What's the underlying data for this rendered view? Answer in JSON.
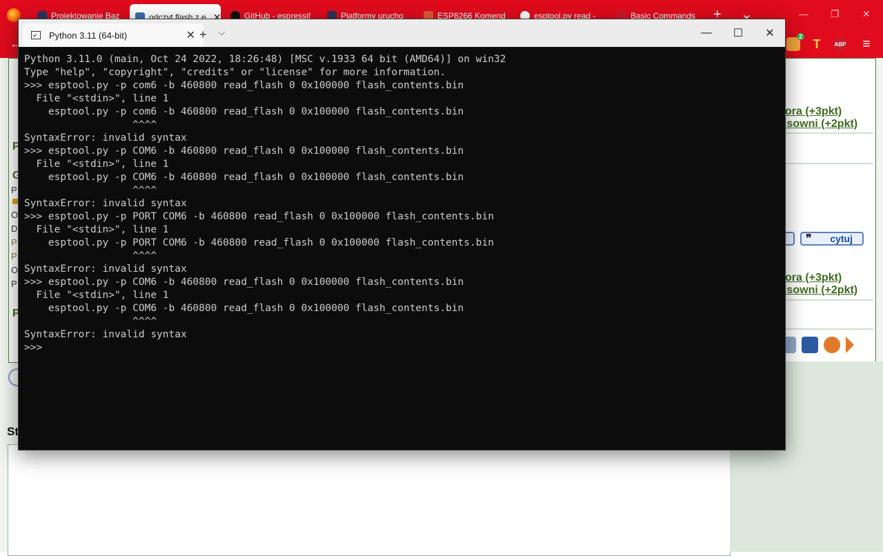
{
  "browser": {
    "tabs": [
      {
        "title": "Projektowanie Baz",
        "active": false
      },
      {
        "title": "odczyt flash z e",
        "active": true
      },
      {
        "title": "GitHub - espressif",
        "active": false
      },
      {
        "title": "Platformy urucho",
        "active": false
      },
      {
        "title": "ESP8266 Komend",
        "active": false
      },
      {
        "title": "esptool.py read -",
        "active": false
      },
      {
        "title": "Basic Commands",
        "active": false
      }
    ],
    "close_glyph": "✕",
    "new_tab_glyph": "+",
    "list_tabs_glyph": "⌄",
    "back_glyph": "←",
    "menu_glyph": "≡",
    "extension_badge": "2",
    "extension_t_label": "T",
    "extension_abp_label": "ABP",
    "window_controls": [
      "—",
      "❐",
      "✕"
    ]
  },
  "webpage": {
    "links_top": [
      "ora (+3pkt)",
      "isowni (+2pkt)"
    ],
    "links_bottom": [
      "ora (+3pkt)",
      "isowni (+2pkt)"
    ],
    "quote_label": "cytuj",
    "quote_icon_glyph": "❞",
    "left_letters": [
      "P",
      "O",
      "D",
      "P",
      "P",
      "O",
      "P"
    ],
    "left_header_1": "P",
    "left_header_2": "G",
    "left_header_3": "P",
    "section_prefix": "St"
  },
  "terminal": {
    "tab_title": "Python 3.11 (64-bit)",
    "tab_close": "✕",
    "new_tab": "+",
    "dropdown": "⌵",
    "controls": {
      "minimize": "—",
      "maximize": "☐",
      "close": "✕"
    },
    "lines": [
      "Python 3.11.0 (main, Oct 24 2022, 18:26:48) [MSC v.1933 64 bit (AMD64)] on win32",
      "Type \"help\", \"copyright\", \"credits\" or \"license\" for more information.",
      ">>> esptool.py -p com6 -b 460800 read_flash 0 0x100000 flash_contents.bin",
      "  File \"<stdin>\", line 1",
      "    esptool.py -p com6 -b 460800 read_flash 0 0x100000 flash_contents.bin",
      "                  ^^^^",
      "SyntaxError: invalid syntax",
      ">>> esptool.py -p COM6 -b 460800 read_flash 0 0x100000 flash_contents.bin",
      "  File \"<stdin>\", line 1",
      "    esptool.py -p COM6 -b 460800 read_flash 0 0x100000 flash_contents.bin",
      "                  ^^^^",
      "SyntaxError: invalid syntax",
      ">>> esptool.py -p PORT COM6 -b 460800 read_flash 0 0x100000 flash_contents.bin",
      "  File \"<stdin>\", line 1",
      "    esptool.py -p PORT COM6 -b 460800 read_flash 0 0x100000 flash_contents.bin",
      "                  ^^^^",
      "SyntaxError: invalid syntax",
      ">>> esptool.py -p COM6 -b 460800 read_flash 0 0x100000 flash_contents.bin",
      "  File \"<stdin>\", line 1",
      "    esptool.py -p COM6 -b 460800 read_flash 0 0x100000 flash_contents.bin",
      "                  ^^^^",
      "SyntaxError: invalid syntax",
      ">>> "
    ]
  },
  "colors": {
    "browser_chrome": "#e00b1c",
    "terminal_bg": "#0c0c0c",
    "terminal_text": "#cccccc",
    "link_green": "#3d6b1f"
  }
}
